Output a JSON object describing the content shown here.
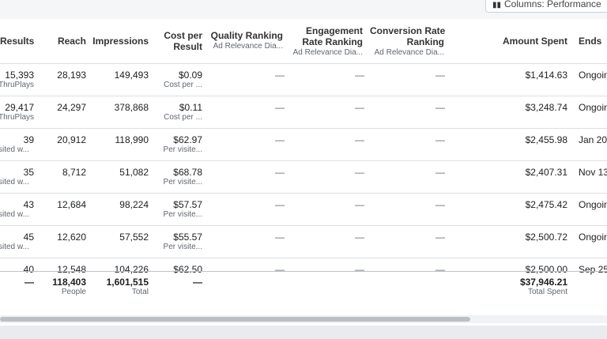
{
  "toolbar": {
    "columns_label": "Columns: Performance"
  },
  "headers": {
    "results": "Results",
    "reach": "Reach",
    "impressions": "Impressions",
    "cost_per_result": [
      "Cost per",
      "Result"
    ],
    "quality_ranking": "Quality Ranking",
    "quality_sub": "Ad Relevance Dia...",
    "engagement_ranking": [
      "Engagement",
      "Rate Ranking"
    ],
    "engagement_sub": "Ad Relevance Dia...",
    "conversion_ranking": [
      "Conversion Rate",
      "Ranking"
    ],
    "conversion_sub": "Ad Relevance Dia...",
    "amount_spent": "Amount Spent",
    "ends": "Ends"
  },
  "rows": [
    {
      "results": "15,393",
      "results_sub": "ThruPlays",
      "reach": "28,193",
      "impressions": "149,493",
      "cost": "$0.09",
      "cost_sub": "Cost per ...",
      "quality": "—",
      "engagement": "—",
      "conversion": "—",
      "spent": "$1,414.63",
      "ends": "Ongoing"
    },
    {
      "results": "29,417",
      "results_sub": "ThruPlays",
      "reach": "24,297",
      "impressions": "378,868",
      "cost": "$0.11",
      "cost_sub": "Cost per ...",
      "quality": "—",
      "engagement": "—",
      "conversion": "—",
      "spent": "$3,248.74",
      "ends": "Ongoing"
    },
    {
      "results": "39",
      "results_sub": "sited w...",
      "reach": "20,912",
      "impressions": "118,990",
      "cost": "$62.97",
      "cost_sub": "Per visite...",
      "quality": "—",
      "engagement": "—",
      "conversion": "—",
      "spent": "$2,455.98",
      "ends": "Jan 20"
    },
    {
      "results": "35",
      "results_sub": "sited w...",
      "reach": "8,712",
      "impressions": "51,082",
      "cost": "$68.78",
      "cost_sub": "Per visite...",
      "quality": "—",
      "engagement": "—",
      "conversion": "—",
      "spent": "$2,407.31",
      "ends": "Nov 13"
    },
    {
      "results": "43",
      "results_sub": "sited w...",
      "reach": "12,684",
      "impressions": "98,224",
      "cost": "$57.57",
      "cost_sub": "Per visite...",
      "quality": "—",
      "engagement": "—",
      "conversion": "—",
      "spent": "$2,475.42",
      "ends": "Ongoing"
    },
    {
      "results": "45",
      "results_sub": "sited w...",
      "reach": "12,620",
      "impressions": "57,552",
      "cost": "$55.57",
      "cost_sub": "Per visite...",
      "quality": "—",
      "engagement": "—",
      "conversion": "—",
      "spent": "$2,500.72",
      "ends": "Ongoing"
    },
    {
      "results": "40",
      "results_sub": "",
      "reach": "12,548",
      "impressions": "104,226",
      "cost": "$62.50",
      "cost_sub": "",
      "quality": "—",
      "engagement": "—",
      "conversion": "—",
      "spent": "$2,500.00",
      "ends": "Sep 25"
    }
  ],
  "totals": {
    "results": "—",
    "reach": "118,403",
    "reach_sub": "People",
    "impressions": "1,601,515",
    "impressions_sub": "Total",
    "cost": "—",
    "spent": "$37,946.21",
    "spent_sub": "Total Spent"
  }
}
